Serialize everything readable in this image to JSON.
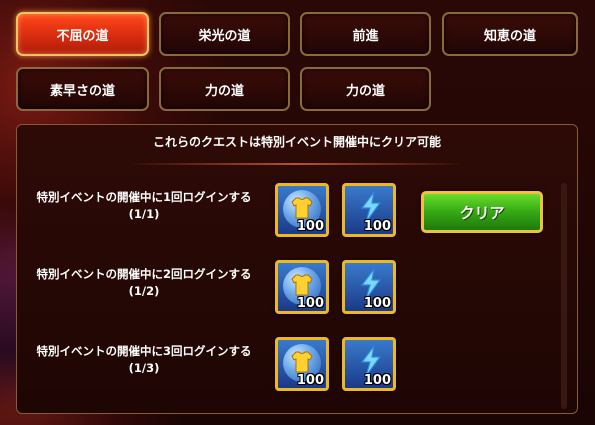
{
  "tabs": [
    {
      "label": "不屈の道",
      "active": true
    },
    {
      "label": "栄光の道",
      "active": false
    },
    {
      "label": "前進",
      "active": false
    },
    {
      "label": "知恵の道",
      "active": false
    },
    {
      "label": "素早さの道",
      "active": false
    },
    {
      "label": "力の道",
      "active": false
    },
    {
      "label": "力の道",
      "active": false
    }
  ],
  "panel": {
    "header": "これらのクエストは特別イベント開催中にクリア可能"
  },
  "quests": [
    {
      "title": "特別イベントの開催中に1回ログインする",
      "progress": "(1/1)",
      "rewards": [
        {
          "icon": "shirt-icon",
          "amount": "100"
        },
        {
          "icon": "lightning-icon",
          "amount": "100"
        }
      ],
      "claim_label": "クリア"
    },
    {
      "title": "特別イベントの開催中に2回ログインする",
      "progress": "(1/2)",
      "rewards": [
        {
          "icon": "shirt-icon",
          "amount": "100"
        },
        {
          "icon": "lightning-icon",
          "amount": "100"
        }
      ]
    },
    {
      "title": "特別イベントの開催中に3回ログインする",
      "progress": "(1/3)",
      "rewards": [
        {
          "icon": "shirt-icon",
          "amount": "100"
        },
        {
          "icon": "lightning-icon",
          "amount": "100"
        }
      ]
    }
  ],
  "colors": {
    "active_tab": "#e03010",
    "claim_button": "#34a814",
    "reward_border": "#f0b820"
  }
}
